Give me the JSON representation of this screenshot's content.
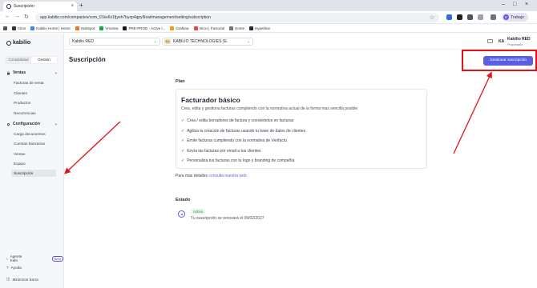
{
  "browser": {
    "tab_title": "Suscripción",
    "url": "app.kabilio.com/companies/com_01ke6x1fjyeh7byxp4qpyl9xat/management/setting/subscription",
    "profile_initial": "R",
    "profile_label": "Trabajo",
    "bookmarks": [
      {
        "label": "Citos",
        "color": "#333333"
      },
      {
        "label": "Kabilio Home | Home",
        "color": "#3b82f6"
      },
      {
        "label": "HubSpot",
        "color": "#f97316"
      },
      {
        "label": "Vmotiva",
        "color": "#16a34a"
      },
      {
        "label": "PRE-PROD - Active l...",
        "color": "#111827"
      },
      {
        "label": "Grafana",
        "color": "#f59e0b"
      },
      {
        "label": "Inicio | Factorial",
        "color": "#ef4444"
      },
      {
        "label": "Home",
        "color": "#6b7280"
      },
      {
        "label": "Hyperline",
        "color": "#1f2937"
      }
    ]
  },
  "sidebar": {
    "logo": "kabilio",
    "toggle": [
      "Contabilidad",
      "Gestión"
    ],
    "ventas": {
      "label": "Ventas",
      "items": [
        "Facturas de venta",
        "Clientes",
        "Productos",
        "Recurrencias"
      ]
    },
    "config": {
      "label": "Configuración",
      "items": [
        "Carga documentos",
        "Cuentas bancarias",
        "Ventas",
        "Equipo",
        "Suscripción"
      ]
    },
    "footer": {
      "agent": "Agente Kabi",
      "beta": "Beta",
      "help": "Ayuda",
      "minimize": "Minimizar barra"
    }
  },
  "header": {
    "company_select": "Kabilio RED",
    "org_badge": "KA",
    "org_select": "KABILIO TECHNOLOGIES SL",
    "user_initials": "KA",
    "user_name": "Kabilio RED",
    "user_role": "Propietario"
  },
  "page": {
    "title": "Suscripción",
    "manage_button": "Gestionar suscripción",
    "plan_label": "Plan",
    "plan_name": "Facturador básico",
    "plan_desc": "Crea, edita y gestiona facturas cumpliendo con la normativa actual de la forma mas sencilla posible",
    "features": [
      "Crea / edita borradores de factura y conviértelos en facturas",
      "Agiliza la creación de facturas usando tu base de datos de clientes",
      "Emite facturas cumpliendo con la normativa de Verifactu",
      "Envía las facturas por email a tus clientes",
      "Personaliza tus facturas con tu logo y branding de compañía"
    ],
    "more_prefix": "Para mas detalles",
    "more_link": "consulta nuestra web",
    "status_label": "Estado",
    "status_badge": "Activo",
    "renewal": "Tu suscripción se renovará el 09/02/2027"
  }
}
